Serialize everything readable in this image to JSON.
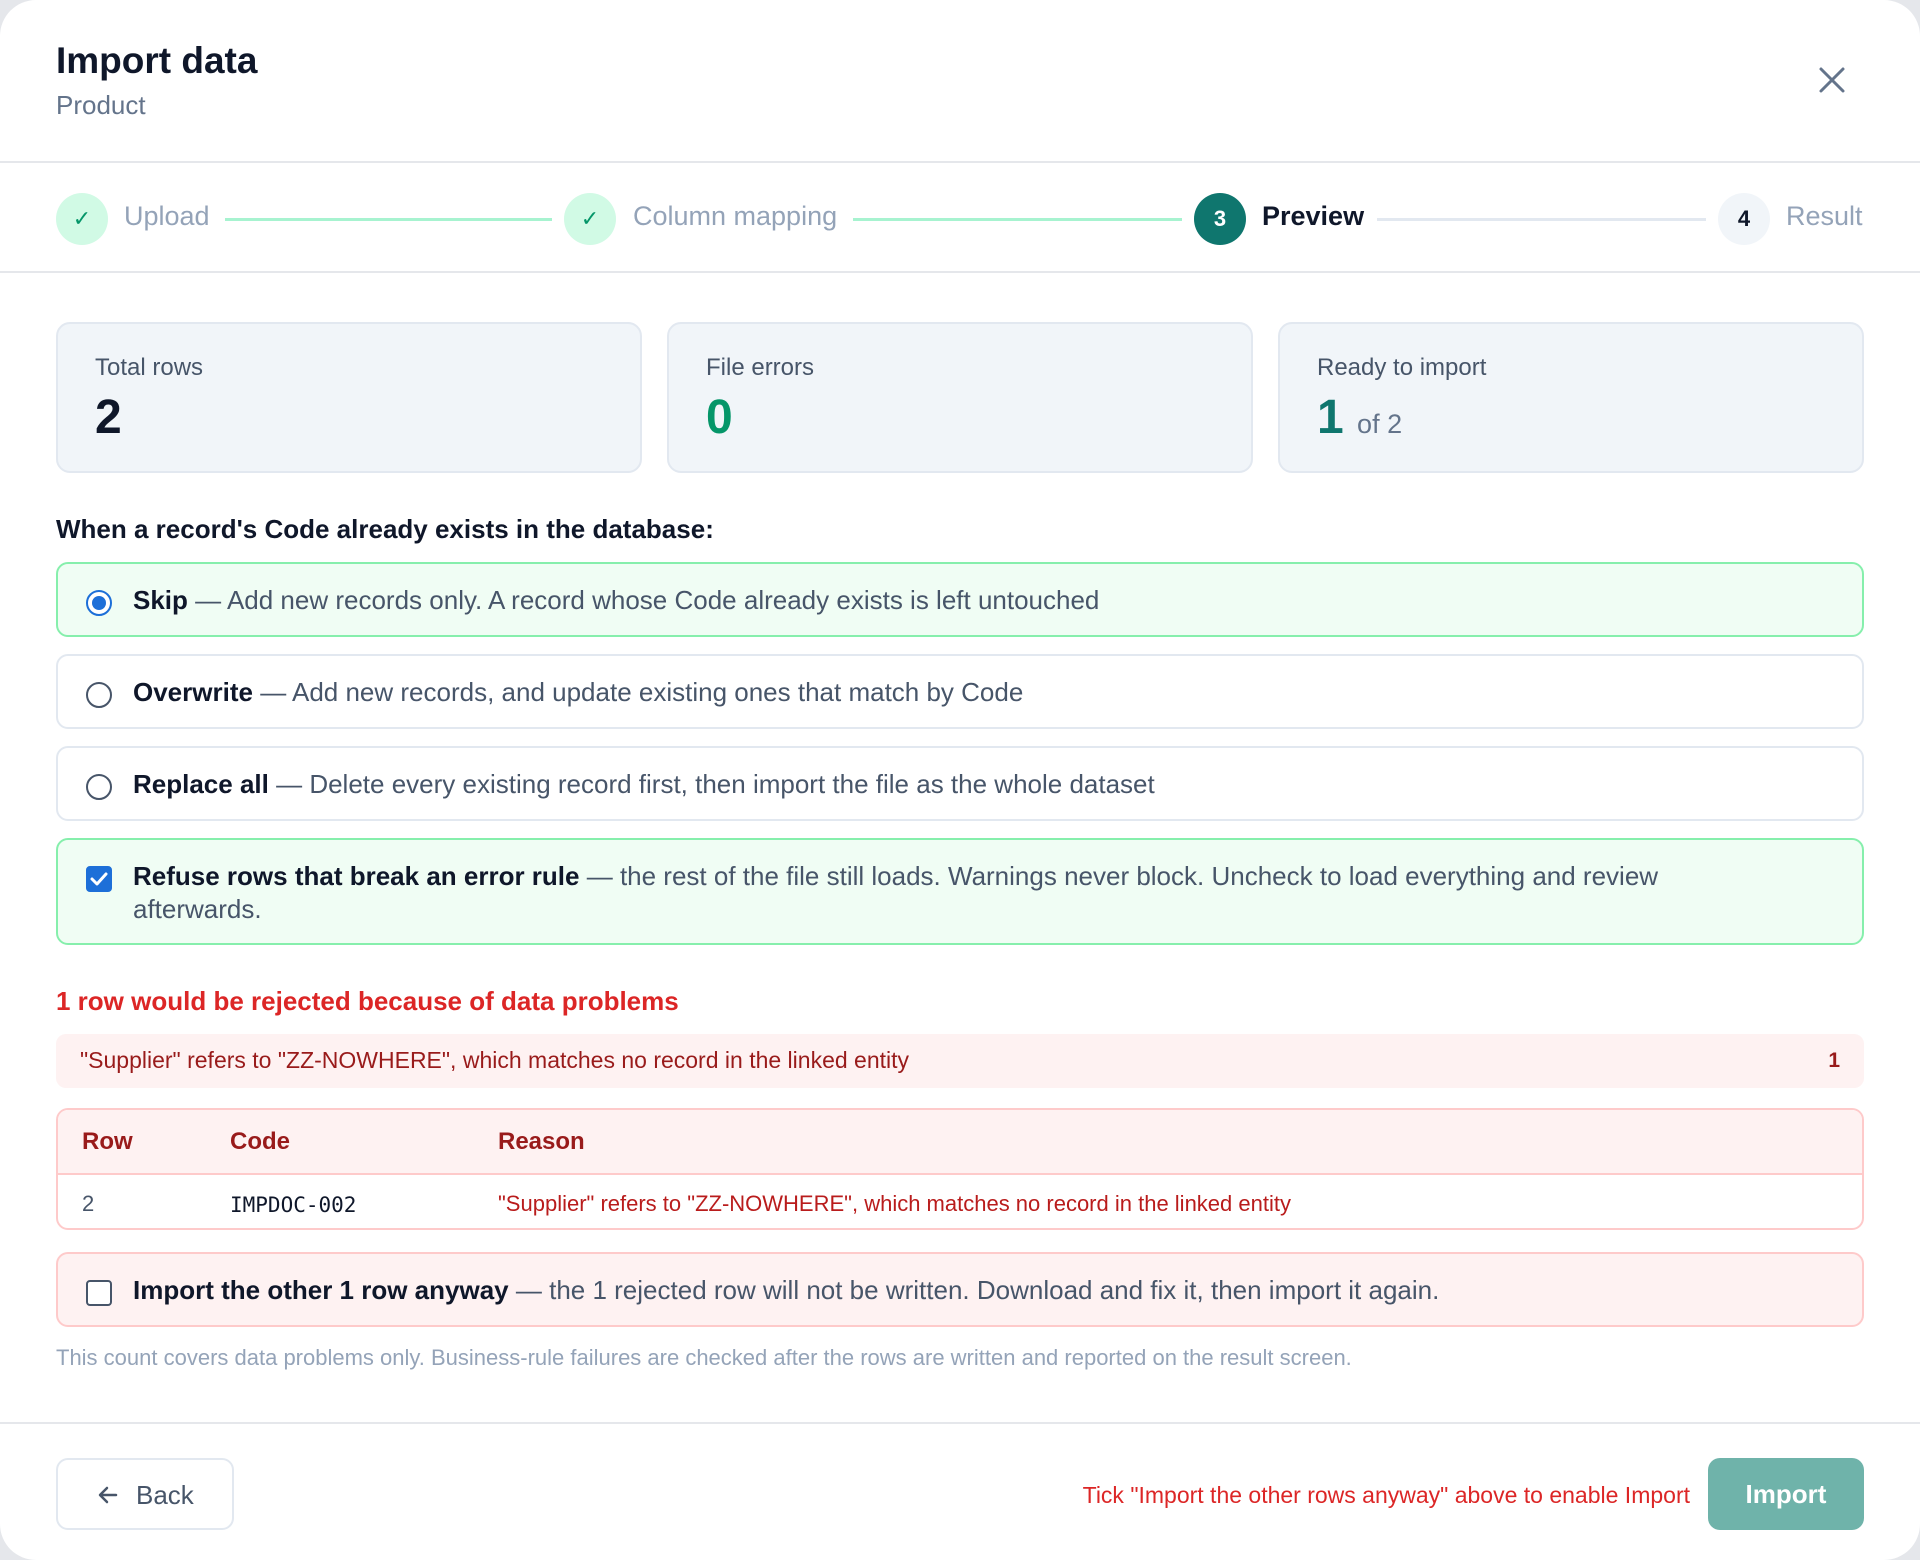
{
  "dialog": {
    "title": "Import data",
    "subtitle": "Product"
  },
  "steps": [
    {
      "label": "Upload",
      "state": "done",
      "marker": "✓"
    },
    {
      "label": "Column mapping",
      "state": "done",
      "marker": "✓"
    },
    {
      "label": "Preview",
      "state": "active",
      "marker": "3"
    },
    {
      "label": "Result",
      "state": "pending",
      "marker": "4"
    }
  ],
  "stats": {
    "total": {
      "label": "Total rows",
      "value": "2"
    },
    "errors": {
      "label": "File errors",
      "value": "0"
    },
    "ready": {
      "label": "Ready to import",
      "value": "1",
      "suffix": "of 2"
    }
  },
  "duplicate_policy": {
    "question": "When a record's Code already exists in the database:",
    "options": [
      {
        "title": "Skip",
        "desc": "— Add new records only. A record whose Code already exists is left untouched",
        "selected": true
      },
      {
        "title": "Overwrite",
        "desc": "— Add new records, and update existing ones that match by Code",
        "selected": false
      },
      {
        "title": "Replace all",
        "desc": "— Delete every existing record first, then import the file as the whole dataset",
        "selected": false
      }
    ]
  },
  "refuse_rows": {
    "title": "Refuse rows that break an error rule",
    "desc": "— the rest of the file still loads. Warnings never block. Uncheck to load everything and review afterwards.",
    "checked": true
  },
  "rejections": {
    "heading": "1 row would be rejected because of data problems",
    "summary": {
      "text": "\"Supplier\" refers to \"ZZ-NOWHERE\", which matches no record in the linked entity",
      "count": "1"
    },
    "table": {
      "headers": [
        "Row",
        "Code",
        "Reason"
      ],
      "rows": [
        {
          "row": "2",
          "code": "IMPDOC-002",
          "reason": "\"Supplier\" refers to \"ZZ-NOWHERE\", which matches no record in the linked entity"
        }
      ]
    }
  },
  "import_anyway": {
    "title": "Import the other 1 row anyway",
    "desc": "— the 1 rejected row will not be written. Download and fix it, then import it again.",
    "checked": false
  },
  "note": "This count covers data problems only. Business-rule failures are checked after the rows are written and reported on the result screen.",
  "footer": {
    "back_label": "Back",
    "hint": "Tick \"Import the other rows anyway\" above to enable Import",
    "import_label": "Import"
  },
  "colors": {
    "accent": "#0f766e",
    "done": "#059669",
    "error": "#dc2626",
    "radio": "#1d6fd8"
  },
  "icons": {
    "close": "close-icon",
    "check": "check-icon",
    "back": "arrow-left-icon"
  }
}
